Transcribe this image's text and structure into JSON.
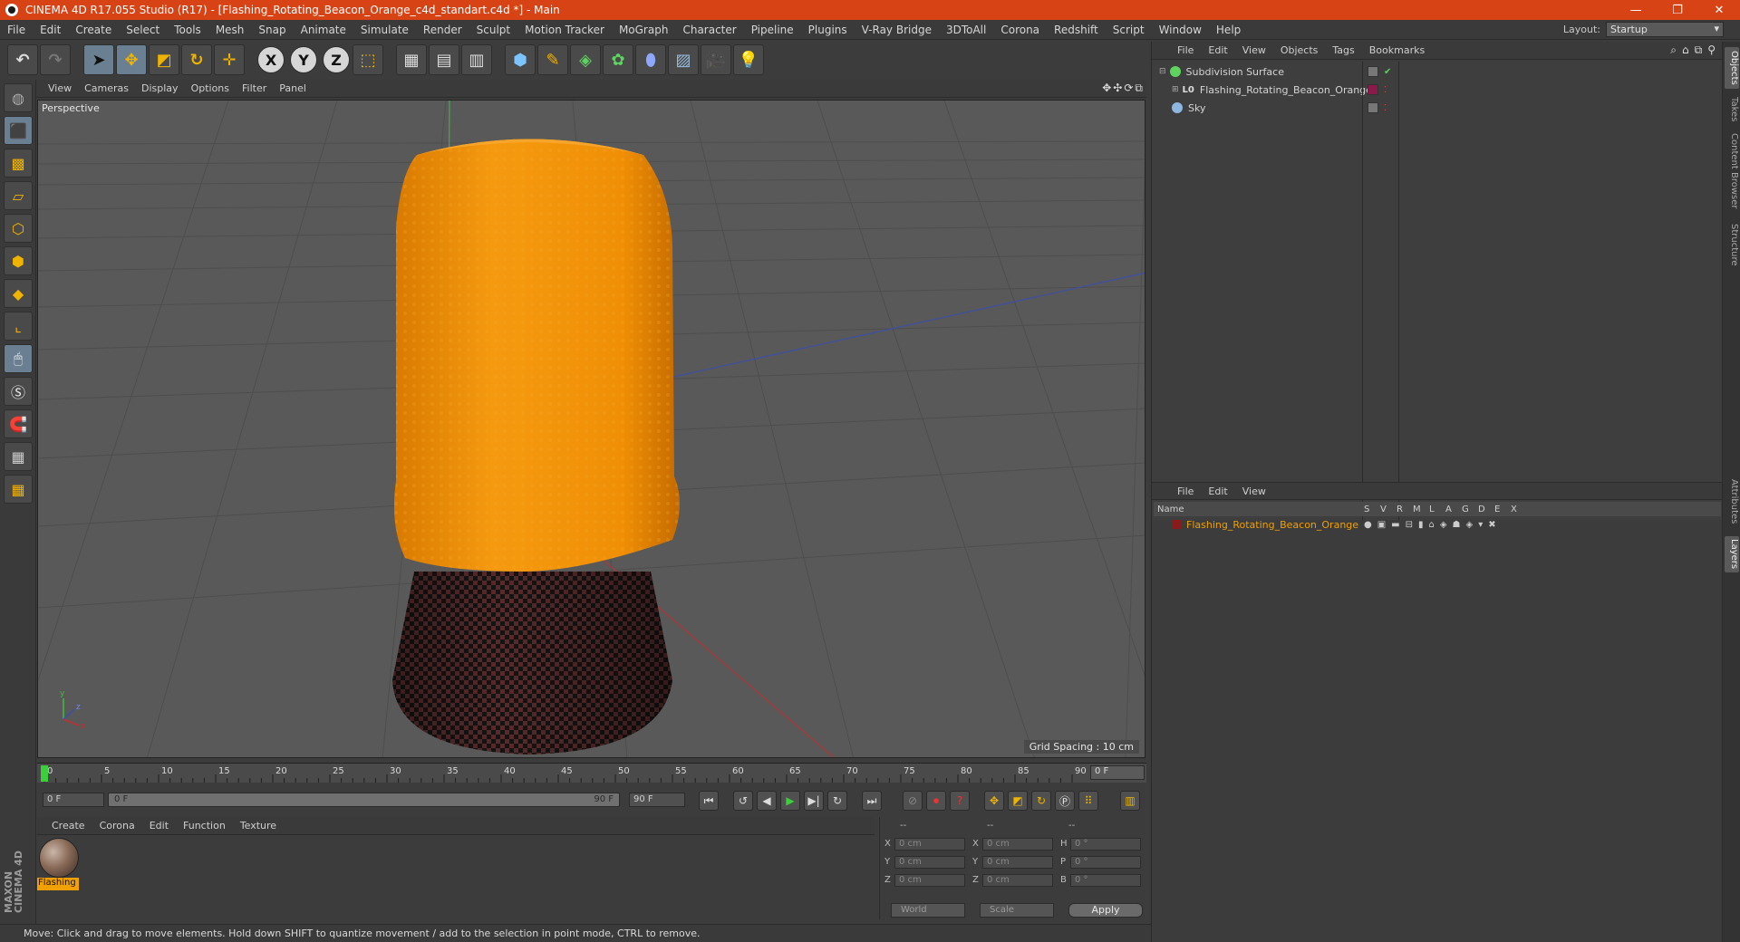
{
  "window": {
    "title": "CINEMA 4D R17.055 Studio (R17) - [Flashing_Rotating_Beacon_Orange_c4d_standart.c4d *] - Main",
    "controls": [
      "—",
      "❐",
      "✕"
    ]
  },
  "menubar": {
    "items": [
      "File",
      "Edit",
      "Create",
      "Select",
      "Tools",
      "Mesh",
      "Snap",
      "Animate",
      "Simulate",
      "Render",
      "Sculpt",
      "Motion Tracker",
      "MoGraph",
      "Character",
      "Pipeline",
      "Plugins",
      "V-Ray Bridge",
      "3DToAll",
      "Corona",
      "Redshift",
      "Script",
      "Window",
      "Help"
    ],
    "layout_label": "Layout:",
    "layout_value": "Startup"
  },
  "viewport": {
    "menu": [
      "View",
      "Cameras",
      "Display",
      "Options",
      "Filter",
      "Panel"
    ],
    "camera_label": "Perspective",
    "grid_spacing": "Grid Spacing : 10 cm"
  },
  "timeline": {
    "ticks": [
      "0",
      "5",
      "10",
      "15",
      "20",
      "25",
      "30",
      "35",
      "40",
      "45",
      "50",
      "55",
      "60",
      "65",
      "70",
      "75",
      "80",
      "85",
      "90"
    ],
    "current_frame": "0 F",
    "start_field": "0 F",
    "range_start": "0 F",
    "range_end": "90 F",
    "end_field": "90 F"
  },
  "materials": {
    "menu": [
      "Create",
      "Corona",
      "Edit",
      "Function",
      "Texture"
    ],
    "items": [
      {
        "name": "Flashing"
      }
    ]
  },
  "coords": {
    "header": [
      "--",
      "--",
      "--"
    ],
    "rows": [
      {
        "l1": "X",
        "v1": "0 cm",
        "l2": "X",
        "v2": "0 cm",
        "l3": "H",
        "v3": "0 °"
      },
      {
        "l1": "Y",
        "v1": "0 cm",
        "l2": "Y",
        "v2": "0 cm",
        "l3": "P",
        "v3": "0 °"
      },
      {
        "l1": "Z",
        "v1": "0 cm",
        "l2": "Z",
        "v2": "0 cm",
        "l3": "B",
        "v3": "0 °"
      }
    ],
    "mode": "World",
    "scale": "Scale",
    "apply": "Apply"
  },
  "status": "Move: Click and drag to move elements. Hold down SHIFT to quantize movement / add to the selection in point mode, CTRL to remove.",
  "object_manager": {
    "menu": [
      "File",
      "Edit",
      "View",
      "Objects",
      "Tags",
      "Bookmarks"
    ],
    "objects": [
      {
        "name": "Subdivision Surface",
        "color": "#5fd35f"
      },
      {
        "name": "Flashing_Rotating_Beacon_Orange",
        "color": "#9a9a9a"
      },
      {
        "name": "Sky",
        "color": "#8fb6e0"
      }
    ]
  },
  "layer_manager": {
    "menu": [
      "File",
      "Edit",
      "View"
    ],
    "columns": [
      "Name",
      "S",
      "V",
      "R",
      "M",
      "L",
      "A",
      "G",
      "D",
      "E",
      "X"
    ],
    "layers": [
      {
        "name": "Flashing_Rotating_Beacon_Orange",
        "color": "#8b1a1a"
      }
    ]
  },
  "side_tabs": [
    "Objects",
    "Takes",
    "Content Browser",
    "Structure",
    "Attributes",
    "Layers"
  ],
  "brand": "MAXON CINEMA 4D",
  "accent": "#d84315"
}
